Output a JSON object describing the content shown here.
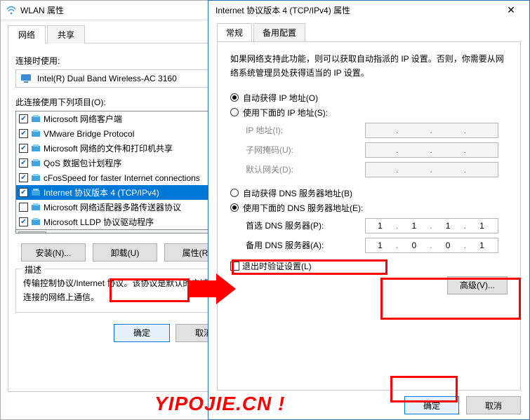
{
  "wlan": {
    "title": "WLAN 属性",
    "tabs": {
      "net": "网络",
      "share": "共享"
    },
    "connect_using": "连接时使用:",
    "adapter": "Intel(R) Dual Band Wireless-AC 3160",
    "items_label": "此连接使用下列项目(O):",
    "items": [
      {
        "checked": true,
        "label": "Microsoft 网络客户端"
      },
      {
        "checked": true,
        "label": "VMware Bridge Protocol"
      },
      {
        "checked": true,
        "label": "Microsoft 网络的文件和打印机共享"
      },
      {
        "checked": true,
        "label": "QoS 数据包计划程序"
      },
      {
        "checked": true,
        "label": "cFosSpeed for faster Internet connections"
      },
      {
        "checked": true,
        "label": "Internet 协议版本 4 (TCP/IPv4)",
        "selected": true
      },
      {
        "checked": false,
        "label": "Microsoft 网络适配器多路传送器协议"
      },
      {
        "checked": true,
        "label": "Microsoft LLDP 协议驱动程序"
      }
    ],
    "buttons": {
      "install": "安装(N)...",
      "uninstall": "卸载(U)",
      "props": "属性(R)"
    },
    "desc_title": "描述",
    "desc_text": "传输控制协议/Internet 协议。该协议是默认的广域网络协议，用于在不同的相互连接的网络上通信。",
    "ok": "确定",
    "cancel": "取消"
  },
  "ipv4": {
    "title": "Internet 协议版本 4 (TCP/IPv4) 属性",
    "tabs": {
      "general": "常规",
      "alt": "备用配置"
    },
    "intro": "如果网络支持此功能，则可以获取自动指派的 IP 设置。否则，你需要从网络系统管理员处获得适当的 IP 设置。",
    "ip_auto": "自动获得 IP 地址(O)",
    "ip_manual": "使用下面的 IP 地址(S):",
    "ip_addr": "IP 地址(I):",
    "subnet": "子网掩码(U):",
    "gateway": "默认网关(D):",
    "dns_auto": "自动获得 DNS 服务器地址(B)",
    "dns_manual": "使用下面的 DNS 服务器地址(E):",
    "dns_pref": "首选 DNS 服务器(P):",
    "dns_alt": "备用 DNS 服务器(A):",
    "dns_pref_val": [
      "1",
      "1",
      "1",
      "1"
    ],
    "dns_alt_val": [
      "1",
      "0",
      "0",
      "1"
    ],
    "validate": "退出时验证设置(L)",
    "advanced": "高级(V)...",
    "ok": "确定",
    "cancel": "取消"
  },
  "watermark": "YIPOJIE.CN !"
}
